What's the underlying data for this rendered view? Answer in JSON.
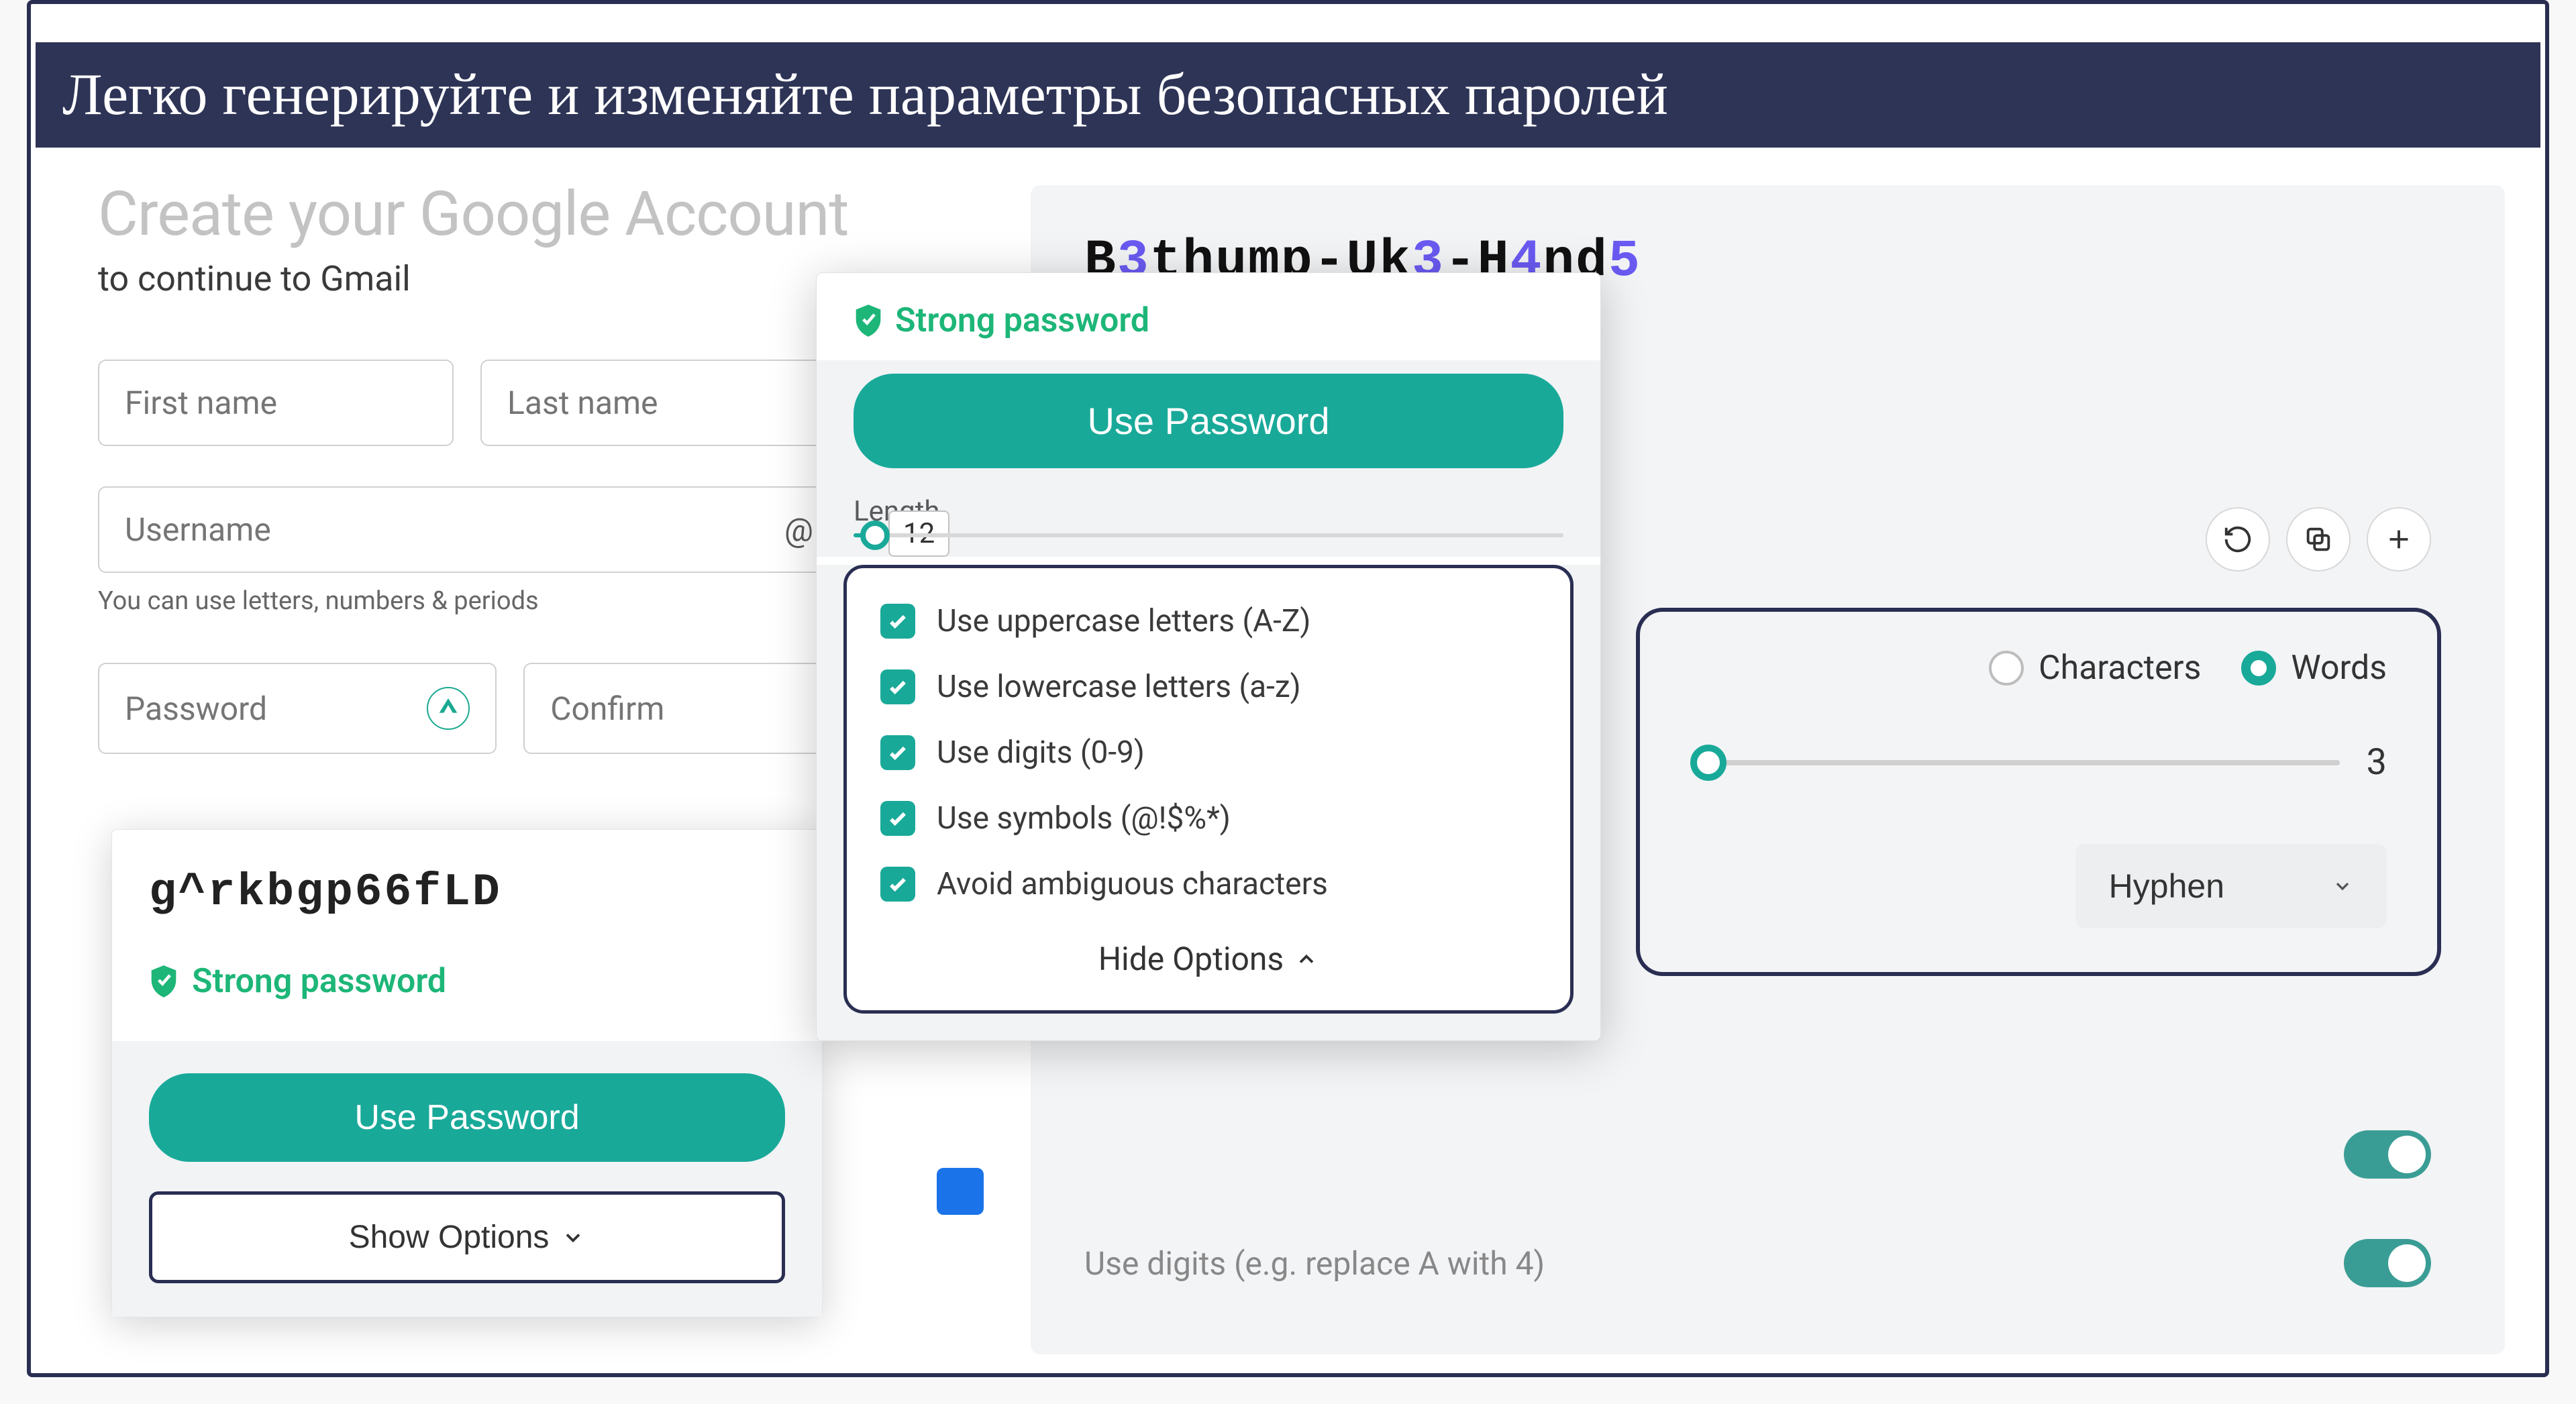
{
  "banner": {
    "caption": "Легко генерируйте и изменяйте параметры безопасных паролей"
  },
  "google": {
    "title": "Create your Google Account",
    "subtitle": "to continue to Gmail",
    "first_name": "First name",
    "last_name": "Last name",
    "username": "Username",
    "at": "@",
    "helper": "You can use letters, numbers & periods",
    "password": "Password",
    "confirm": "Confirm"
  },
  "left_popup": {
    "generated": "g^rkbgp66fLD",
    "strong": "Strong password",
    "use": "Use Password",
    "show_options": "Show Options"
  },
  "center_popup": {
    "strong": "Strong password",
    "use": "Use Password",
    "length_label": "Length",
    "length_value": "12",
    "options": {
      "upper": "Use uppercase letters (A-Z)",
      "lower": "Use lowercase letters (a-z)",
      "digits": "Use digits (0-9)",
      "symbols": "Use symbols (@!$%*)",
      "ambiguous": "Avoid ambiguous characters"
    },
    "hide_options": "Hide Options"
  },
  "right_panel": {
    "password_segments": [
      {
        "text": "B",
        "class": "pc-black"
      },
      {
        "text": "3",
        "class": "pc-purple"
      },
      {
        "text": "thump-Uk",
        "class": "pc-black"
      },
      {
        "text": "3",
        "class": "pc-purple"
      },
      {
        "text": "-H",
        "class": "pc-black"
      },
      {
        "text": "4",
        "class": "pc-purple"
      },
      {
        "text": "nd",
        "class": "pc-black"
      },
      {
        "text": "5",
        "class": "pc-purple"
      }
    ],
    "radio_characters": "Characters",
    "radio_words": "Words",
    "word_count": "3",
    "separator": "Hyphen",
    "toggle1_label": "",
    "toggle2_label": "Use digits (e.g. replace A with 4)"
  }
}
